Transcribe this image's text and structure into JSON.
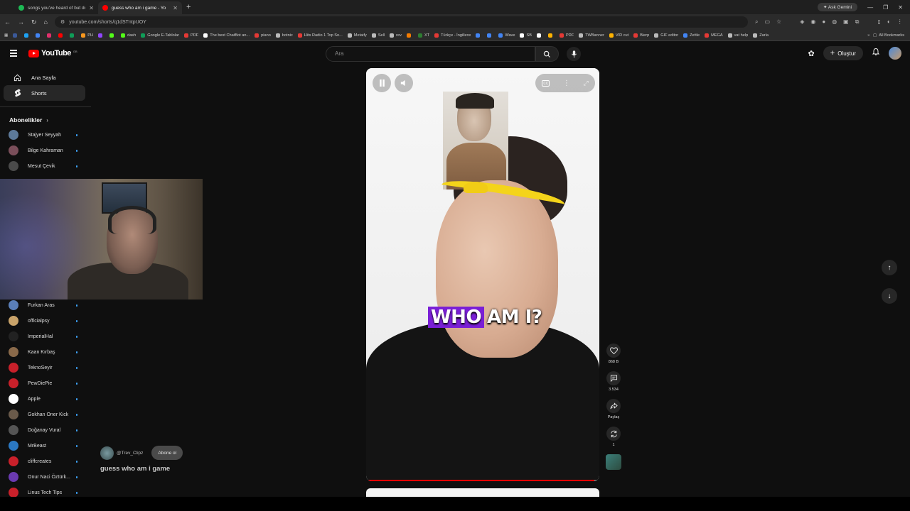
{
  "browser": {
    "tabs": [
      {
        "title": "songs you've heard of but don't",
        "favicon_color": "#1db954",
        "active": false
      },
      {
        "title": "guess who am i game - Yo",
        "favicon_color": "#ff0000",
        "active": true
      }
    ],
    "new_tab_icon": "plus-icon",
    "ask_gemini": "Ask Gemini",
    "url": "youtube.com/shorts/q1dSTntpUOY",
    "bookmarks": [
      {
        "label": "",
        "color": "#3b5998"
      },
      {
        "label": "",
        "color": "#1da1f2"
      },
      {
        "label": "",
        "color": "#4285f4"
      },
      {
        "label": "",
        "color": "#e1306c"
      },
      {
        "label": "",
        "color": "#ff0000"
      },
      {
        "label": "",
        "color": "#0f9d58"
      },
      {
        "label": "PH",
        "color": "#f7971e"
      },
      {
        "label": "",
        "color": "#9146ff"
      },
      {
        "label": "",
        "color": "#53fc18"
      },
      {
        "label": "dash",
        "color": "#53fc18"
      },
      {
        "label": "Google E-Tablolar",
        "color": "#0f9d58"
      },
      {
        "label": "PDF",
        "color": "#e53935"
      },
      {
        "label": "The best ChatBot an...",
        "color": "#ffffff"
      },
      {
        "label": "piano",
        "color": "#e53935"
      },
      {
        "label": "botnic",
        "color": "#bbbbbb"
      },
      {
        "label": "Hits Radio 1 Top So...",
        "color": "#e53935"
      },
      {
        "label": "Metaify",
        "color": "#bbbbbb"
      },
      {
        "label": "Sell",
        "color": "#bbbbbb"
      },
      {
        "label": "rev",
        "color": "#bbbbbb"
      },
      {
        "label": "",
        "color": "#f57c00"
      },
      {
        "label": "XT",
        "color": "#2e7d32"
      },
      {
        "label": "Türkçe - İngilizce",
        "color": "#e53935"
      },
      {
        "label": "",
        "color": "#4285f4"
      },
      {
        "label": "",
        "color": "#4285f4"
      },
      {
        "label": "Wave",
        "color": "#4285f4"
      },
      {
        "label": "SB",
        "color": "#ffffff"
      },
      {
        "label": "",
        "color": "#ffffff"
      },
      {
        "label": "",
        "color": "#ffb300"
      },
      {
        "label": "PDF",
        "color": "#e53935"
      },
      {
        "label": "TWBanner",
        "color": "#bbbbbb"
      },
      {
        "label": "VID cut",
        "color": "#ffb300"
      },
      {
        "label": "Bierp",
        "color": "#e53935"
      },
      {
        "label": "GIF editor",
        "color": "#bbbbbb"
      },
      {
        "label": "Zettle",
        "color": "#4285f4"
      },
      {
        "label": "MEGA",
        "color": "#e53935"
      },
      {
        "label": "vat help",
        "color": "#bbbbbb"
      },
      {
        "label": "Zarla",
        "color": "#bbbbbb"
      }
    ],
    "all_bookmarks": "All Bookmarks"
  },
  "header": {
    "logo_text": "YouTube",
    "country_code": "GB",
    "search_placeholder": "Ara",
    "create_label": "Oluştur"
  },
  "sidebar": {
    "nav": [
      {
        "label": "Ana Sayfa",
        "icon": "home-icon",
        "selected": false
      },
      {
        "label": "Shorts",
        "icon": "shorts-icon",
        "selected": true
      }
    ],
    "subscriptions_header": "Abonelikler",
    "subscriptions_top": [
      {
        "name": "Stajyer Seyyah",
        "color": "#5d7a9a"
      },
      {
        "name": "Bilge Kahraman",
        "color": "#7a4e5a"
      },
      {
        "name": "Mesut Çevik",
        "color": "#4a4a4a"
      }
    ],
    "subscriptions_bottom": [
      {
        "name": "Furkan Aras",
        "color": "#5a7fb8"
      },
      {
        "name": "officialpsy",
        "color": "#c9a36a"
      },
      {
        "name": "ImperialHal",
        "color": "#222222"
      },
      {
        "name": "Kaan Kırbaş",
        "color": "#8a6a4a"
      },
      {
        "name": "TeknoSeyir",
        "color": "#c8202a"
      },
      {
        "name": "PewDiePie",
        "color": "#c8202a"
      },
      {
        "name": "Apple",
        "color": "#ffffff"
      },
      {
        "name": "Gokhan Oner Kick",
        "color": "#6a5a4a"
      },
      {
        "name": "Doğanay Vural",
        "color": "#555555"
      },
      {
        "name": "MrBeast",
        "color": "#2b78c2"
      },
      {
        "name": "cliffcreates",
        "color": "#c8202a"
      },
      {
        "name": "Onur Naci Öztürk...",
        "color": "#6a3ab0"
      },
      {
        "name": "Linus Tech Tips",
        "color": "#c8202a"
      }
    ]
  },
  "short": {
    "caption_highlight": "WHO",
    "caption_rest": "AM I?",
    "progress_fraction": 0.98,
    "channel": "@Trev_Clipz",
    "subscribe": "Abone ol",
    "title": "guess who am i game",
    "actions": [
      {
        "icon": "heart-icon",
        "label": "868 B"
      },
      {
        "icon": "comment-icon",
        "label": "3.534"
      },
      {
        "icon": "share-icon",
        "label": "Paylaş"
      },
      {
        "icon": "remix-icon",
        "label": "1"
      }
    ]
  }
}
